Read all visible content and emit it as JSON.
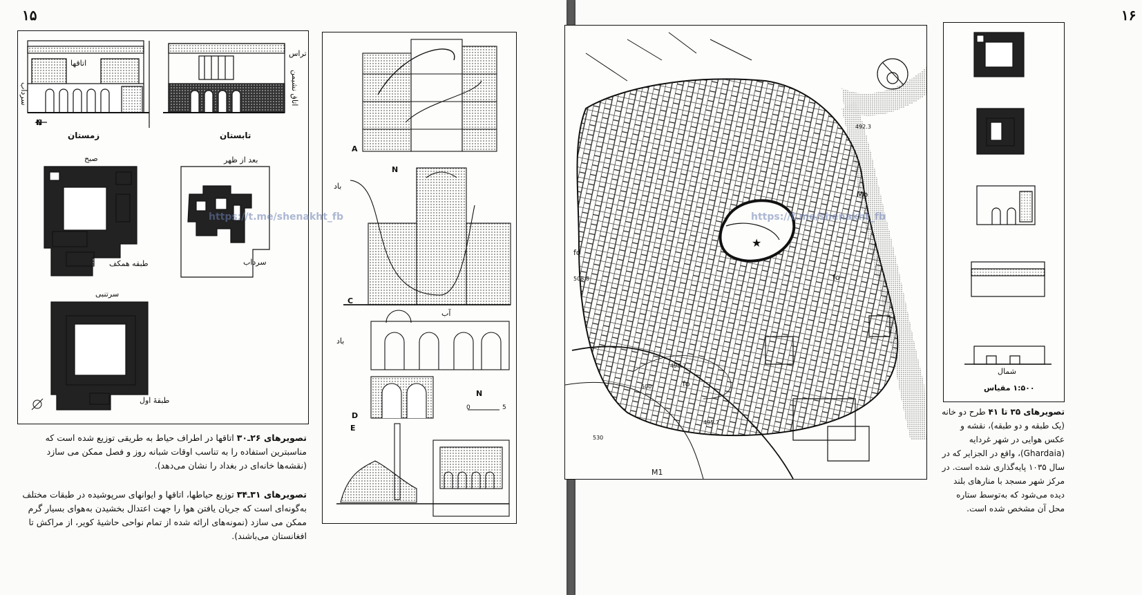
{
  "left_page": {
    "page_number": "۱۵",
    "labels": {
      "winter": "زمستان",
      "summer": "تابستان",
      "rooms": "اتاقها",
      "trass": "تراس",
      "living_room": "اتاق نشیمن",
      "cellar_side": "سرداب",
      "north": "N",
      "morning": "صبح",
      "afternoon": "بعد از ظهر",
      "ground_floor": "طبقه همکف",
      "cellar": "سرداب",
      "sartambi": "سرتنبی",
      "first_floor": "طبقهٔ اول",
      "wind_1": "باد",
      "wind_2": "باد",
      "water": "آب",
      "sec_a": "A",
      "sec_c": "C",
      "sec_d": "D",
      "sec_e": "E",
      "n_c": "N",
      "n_d": "N",
      "scale_0": "0",
      "scale_5": "5"
    },
    "caption_1_bold": "تصویرهای ۲۶ـ۳۰",
    "caption_1": " اتاقها در اطراف حیاط به طریقی توزیع شده است که مناسبترین استفاده را به تناسب اوقات شبانه روز و فصل ممکن می سازد (نقشه‌ها خانه‌ای در بغداد را نشان می‌دهد).",
    "caption_2_bold": "تصویرهای ۳۱ـ۳۴",
    "caption_2": " توزیع حیاطها، اتاقها و ایوانهای سرپوشیده در طبقات مختلف به‌گونه‌ای است که جریان یافتن هوا را جهت اعتدال بخشیدن به‌هوای بسیار گرم ممکن می سازد (نمونه‌های ارائه شده از تمام نواحی حاشیهٔ کویر، از مراکش تا افغانستان می‌باشند).",
    "watermark": "https://t.me/shenakht_fb"
  },
  "right_page": {
    "page_number": "۱۶",
    "map_labels": {
      "fo_1": "fo",
      "fo_2": "fo",
      "fo_3": "fo",
      "elev_1": "508.8",
      "elev_2": "492.3",
      "elev_3": "498.7",
      "elev_4": "495.7",
      "contour_1": "500",
      "contour_2": "530",
      "mo": "Mo",
      "m1": "M1"
    },
    "plan_labels": {
      "north": "شمال",
      "scale": "۱:۵۰۰ مقیاس"
    },
    "caption_bold": "تصویرهای ۳۵ تا ۴۱",
    "caption": " طرح دو خانه (یک طبقه و دو طبقه)، نقشه و عکس هوایی در شهر غردایه (Ghardaia)، واقع در الجزایر که در سال ۱۰۳۵ پایه‌گذاری شده است. در مرکز شهر مسجد با منارهای بلند دیده می‌شود که به‌توسط ستاره محل آن مشخص شده است.",
    "watermark": "https://t.me/shenakht_fb"
  }
}
